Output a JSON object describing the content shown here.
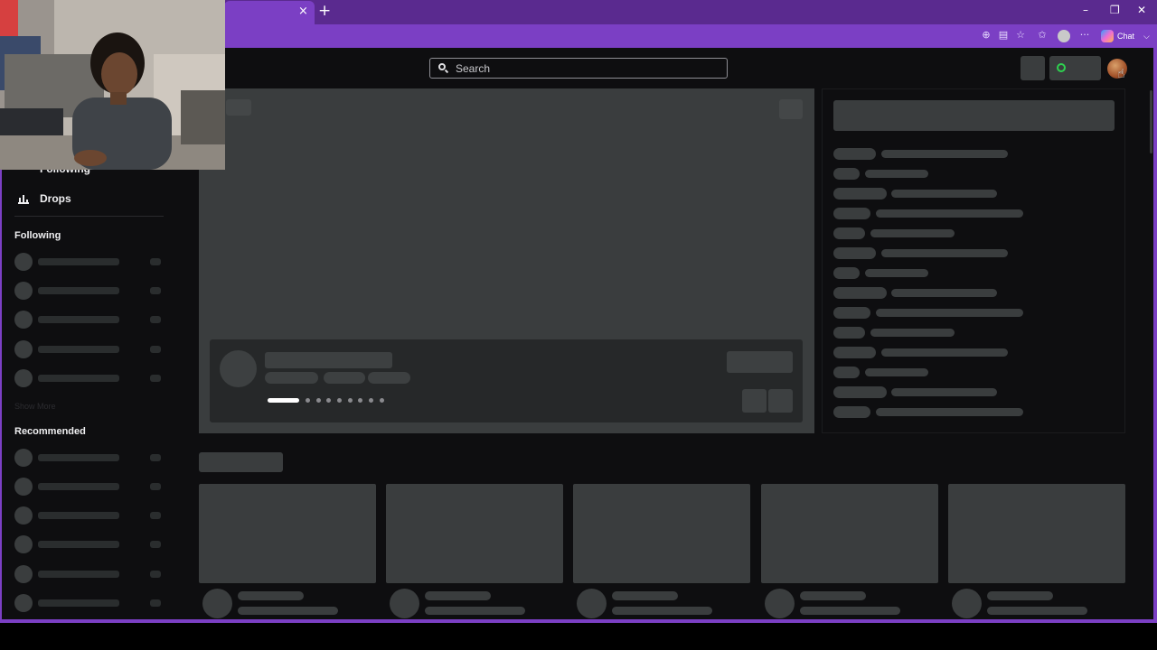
{
  "browser": {
    "tab_close_glyph": "×",
    "new_tab_glyph": "+",
    "window_controls": [
      "–",
      "❐",
      "✕"
    ],
    "toolbar_icons": [
      "zoom-icon",
      "reader-icon",
      "favorite-star-icon",
      "favorites-icon",
      "profile-icon",
      "more-icon"
    ],
    "more_glyph": "···",
    "copilot_label": "Chat",
    "copilot_chevron": "⌵"
  },
  "search": {
    "placeholder": "Search"
  },
  "sidebar": {
    "partial_item_label": "Following",
    "drops_label": "Drops",
    "following_header": "Following",
    "show_more": "Show More",
    "recommended_header": "Recommended"
  },
  "featured": {
    "carousel_dots": 9,
    "active_dot": 0
  },
  "colors": {
    "brand_purple": "#7b3fc4",
    "tab_bar": "#5a2a8f",
    "page_bg": "#0e0e10",
    "skeleton": "#3a3d3e",
    "online_green": "#2ed14f"
  },
  "cursor_glyph": "☝"
}
